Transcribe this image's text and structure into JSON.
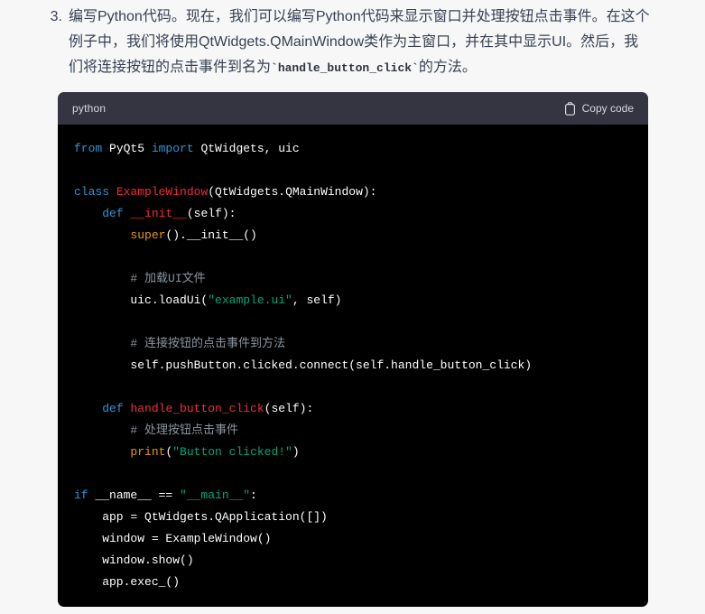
{
  "page": {
    "background_color": "#f7f7f8"
  },
  "paragraph": {
    "number": "3.",
    "text_before": "编写Python代码。现在，我们可以编写Python代码来显示窗口并处理按钮点击事件。在这个例子中，我们将使用QtWidgets.QMainWindow类作为主窗口，并在其中显示UI。然后，我们将连接按钮的点击事件到名为",
    "inline_code": "`handle_button_click`",
    "text_after": "的方法。"
  },
  "code_block": {
    "language": "python",
    "copy_label": "Copy code",
    "copy_icon": "clipboard-icon",
    "colors": {
      "header_bg": "#343541",
      "body_bg": "#000000",
      "keyword": "#2e95d3",
      "function": "#f22c3d",
      "builtin": "#e9950c",
      "string": "#00a67d",
      "comment": "#8b949e",
      "plain": "#ffffff"
    },
    "lines": [
      [
        [
          "kw",
          "from"
        ],
        [
          "pl",
          " PyQt5 "
        ],
        [
          "kw",
          "import"
        ],
        [
          "pl",
          " QtWidgets, uic"
        ]
      ],
      [],
      [
        [
          "kw",
          "class"
        ],
        [
          "pl",
          " "
        ],
        [
          "fn",
          "ExampleWindow"
        ],
        [
          "pl",
          "(QtWidgets.QMainWindow):"
        ]
      ],
      [
        [
          "pl",
          "    "
        ],
        [
          "kw",
          "def"
        ],
        [
          "pl",
          " "
        ],
        [
          "fn",
          "__init__"
        ],
        [
          "pl",
          "(self):"
        ]
      ],
      [
        [
          "pl",
          "        "
        ],
        [
          "bi",
          "super"
        ],
        [
          "pl",
          "().__init__()"
        ]
      ],
      [],
      [
        [
          "pl",
          "        "
        ],
        [
          "com",
          "# 加载UI文件"
        ]
      ],
      [
        [
          "pl",
          "        uic.loadUi("
        ],
        [
          "str",
          "\"example.ui\""
        ],
        [
          "pl",
          ", self)"
        ]
      ],
      [],
      [
        [
          "pl",
          "        "
        ],
        [
          "com",
          "# 连接按钮的点击事件到方法"
        ]
      ],
      [
        [
          "pl",
          "        self.pushButton.clicked.connect(self.handle_button_click)"
        ]
      ],
      [],
      [
        [
          "pl",
          "    "
        ],
        [
          "kw",
          "def"
        ],
        [
          "pl",
          " "
        ],
        [
          "fn",
          "handle_button_click"
        ],
        [
          "pl",
          "(self):"
        ]
      ],
      [
        [
          "pl",
          "        "
        ],
        [
          "com",
          "# 处理按钮点击事件"
        ]
      ],
      [
        [
          "pl",
          "        "
        ],
        [
          "bi",
          "print"
        ],
        [
          "pl",
          "("
        ],
        [
          "str",
          "\"Button clicked!\""
        ],
        [
          "pl",
          ")"
        ]
      ],
      [],
      [
        [
          "kw",
          "if"
        ],
        [
          "pl",
          " __name__ == "
        ],
        [
          "str",
          "\"__main__\""
        ],
        [
          "pl",
          ":"
        ]
      ],
      [
        [
          "pl",
          "    app = QtWidgets.QApplication([])"
        ]
      ],
      [
        [
          "pl",
          "    window = ExampleWindow()"
        ]
      ],
      [
        [
          "pl",
          "    window.show()"
        ]
      ],
      [
        [
          "pl",
          "    app.exec_()"
        ]
      ]
    ]
  }
}
